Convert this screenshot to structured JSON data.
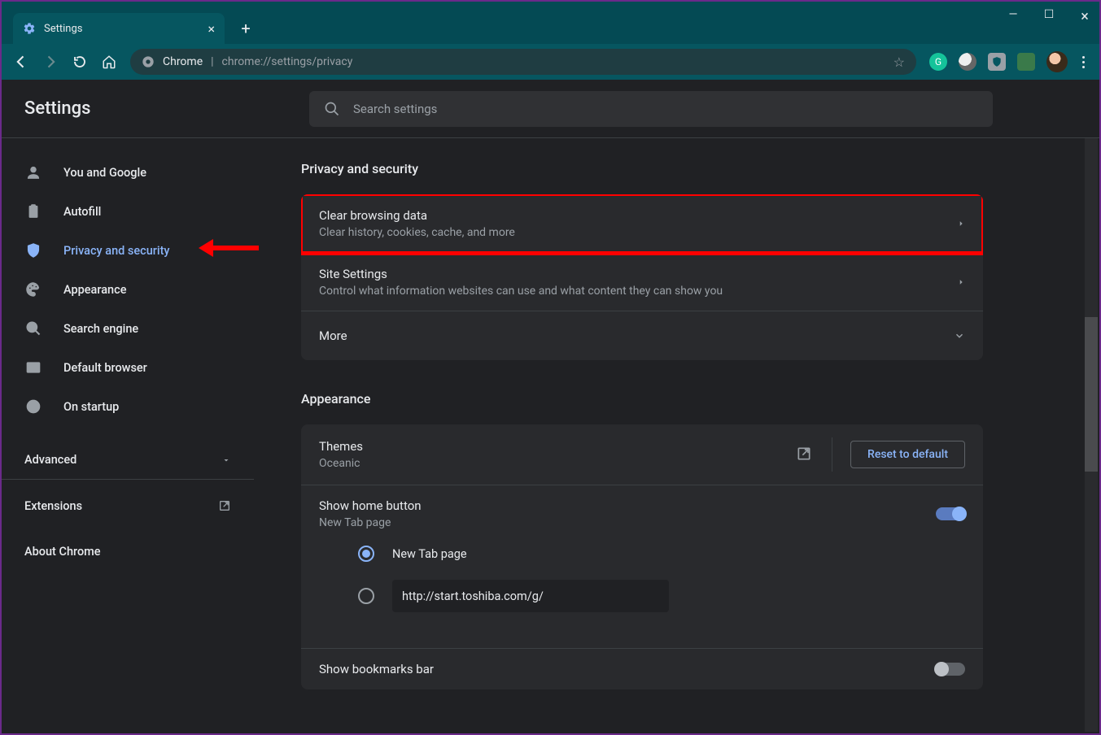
{
  "window": {
    "tab_title": "Settings",
    "omnibox": {
      "origin": "Chrome",
      "url": "chrome://settings/privacy"
    }
  },
  "header": {
    "title": "Settings",
    "search_placeholder": "Search settings"
  },
  "sidebar": {
    "items": [
      {
        "label": "You and Google"
      },
      {
        "label": "Autofill"
      },
      {
        "label": "Privacy and security"
      },
      {
        "label": "Appearance"
      },
      {
        "label": "Search engine"
      },
      {
        "label": "Default browser"
      },
      {
        "label": "On startup"
      }
    ],
    "advanced": "Advanced",
    "extensions": "Extensions",
    "about": "About Chrome"
  },
  "privacy_section": {
    "title": "Privacy and security",
    "rows": [
      {
        "title": "Clear browsing data",
        "sub": "Clear history, cookies, cache, and more"
      },
      {
        "title": "Site Settings",
        "sub": "Control what information websites can use and what content they can show you"
      },
      {
        "title": "More"
      }
    ]
  },
  "appearance_section": {
    "title": "Appearance",
    "themes": {
      "title": "Themes",
      "sub": "Oceanic",
      "reset": "Reset to default"
    },
    "home": {
      "title": "Show home button",
      "sub": "New Tab page",
      "radio_newtab": "New Tab page",
      "url_value": "http://start.toshiba.com/g/"
    },
    "bookmarks": {
      "title": "Show bookmarks bar"
    }
  }
}
